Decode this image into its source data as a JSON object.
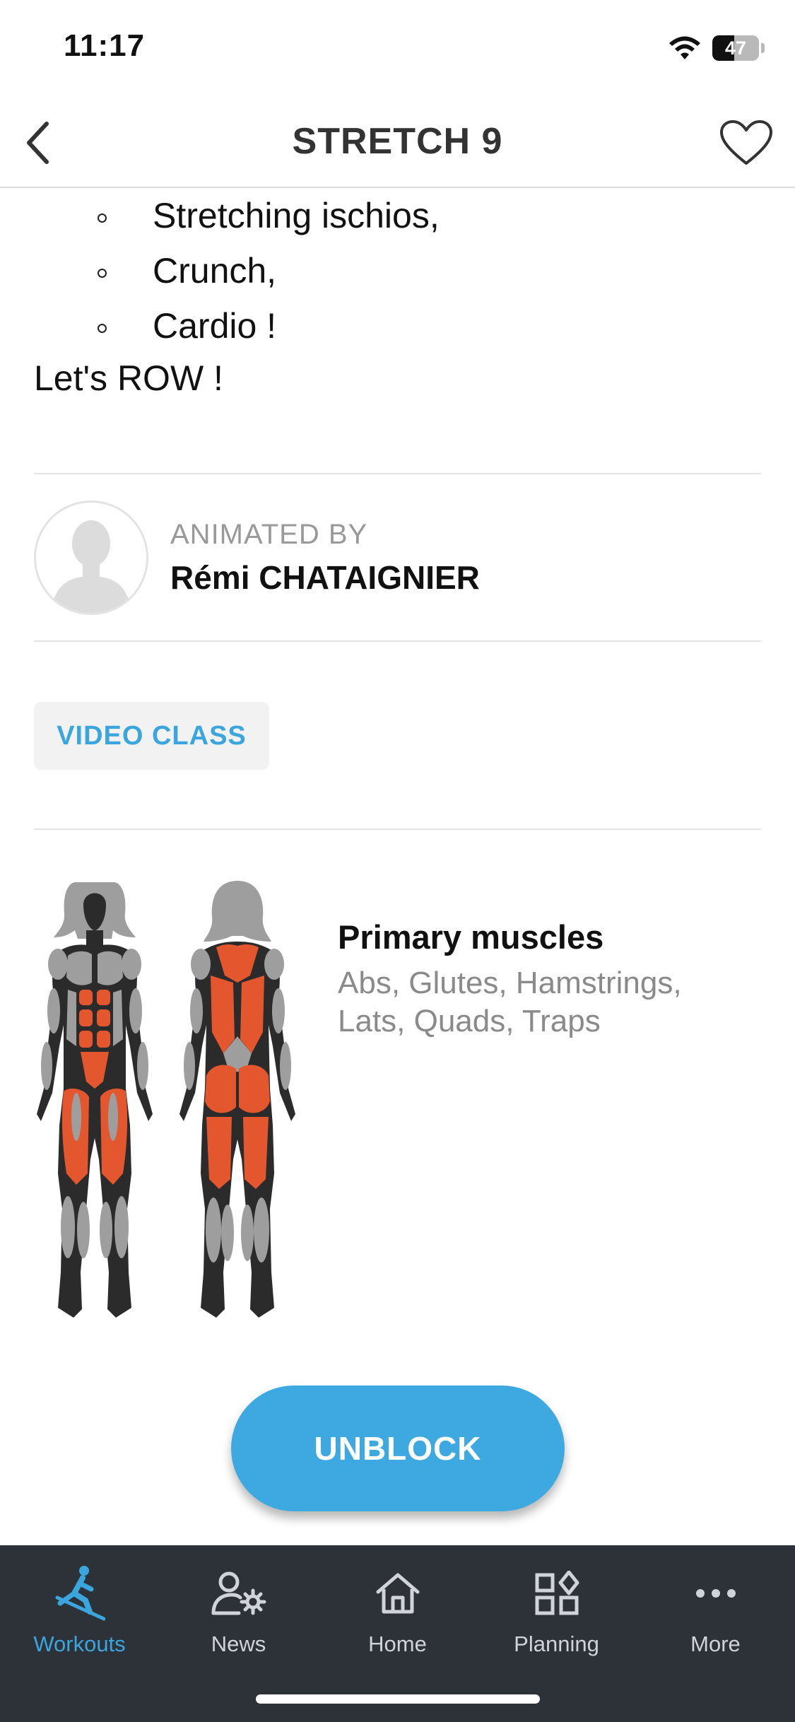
{
  "status_bar": {
    "time": "11:17",
    "battery": "47",
    "battery_level": 0.47
  },
  "nav": {
    "title": "STRETCH 9",
    "back_icon": "chevron-left-icon",
    "favorite_icon": "heart-outline-icon"
  },
  "description": {
    "bullets": [
      "Stretching ischios,",
      "Crunch,",
      "Cardio !"
    ],
    "closing": "Let's ROW !"
  },
  "coach": {
    "label": "ANIMATED BY",
    "name": "Rémi CHATAIGNIER",
    "avatar_icon": "person-silhouette-icon"
  },
  "video_button": "VIDEO CLASS",
  "muscles": {
    "title": "Primary muscles",
    "list": "Abs, Glutes, Hamstrings, Lats, Quads, Traps"
  },
  "unblock_button": "UNBLOCK",
  "tabs": [
    {
      "label": "Workouts",
      "icon": "rowing-person-icon",
      "active": true
    },
    {
      "label": "News",
      "icon": "user-gear-icon",
      "active": false
    },
    {
      "label": "Home",
      "icon": "home-icon",
      "active": false
    },
    {
      "label": "Planning",
      "icon": "grid-icon",
      "active": false
    },
    {
      "label": "More",
      "icon": "more-dots-icon",
      "active": false
    }
  ],
  "colors": {
    "accent": "#3aa6dd",
    "muscle_highlight": "#e4572e",
    "tab_bar_bg": "#2d3138"
  }
}
